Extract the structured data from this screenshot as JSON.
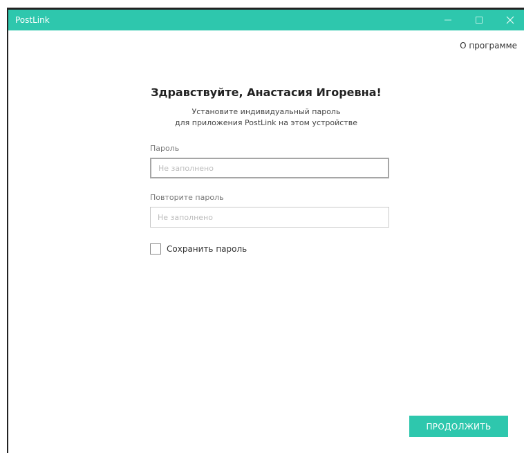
{
  "titlebar": {
    "app_title": "PostLink",
    "minimize_icon": "minimize-icon",
    "maximize_icon": "maximize-icon",
    "close_icon": "close-icon"
  },
  "header": {
    "about_link": "О программе"
  },
  "main": {
    "greeting": "Здравствуйте, Анастасия Игоревна!",
    "subtitle_line1": "Установите индивидуальный пароль",
    "subtitle_line2": "для приложения PostLink на этом устройстве",
    "password": {
      "label": "Пароль",
      "placeholder": "Не заполнено",
      "value": ""
    },
    "password_repeat": {
      "label": "Повторите пароль",
      "placeholder": "Не заполнено",
      "value": ""
    },
    "save_password": {
      "label": "Сохранить пароль",
      "checked": false
    },
    "continue_label": "ПРОДОЛЖИТЬ"
  },
  "colors": {
    "accent": "#2ec7ad"
  }
}
